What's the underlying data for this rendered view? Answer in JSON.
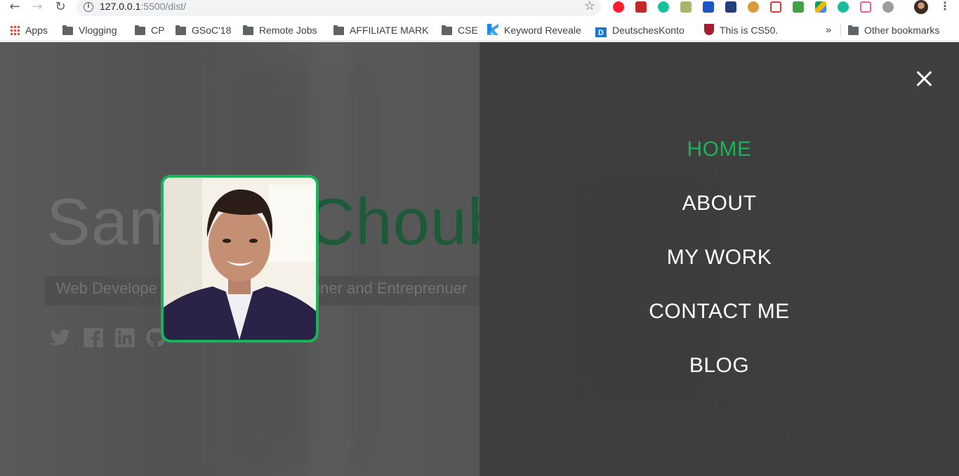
{
  "browser": {
    "url_host": "127.0.0.1",
    "url_path": ":5500/dist/",
    "bookmarks": [
      {
        "label": "Apps",
        "icon": "apps-grid-icon"
      },
      {
        "label": "Vlogging",
        "icon": "folder-icon"
      },
      {
        "label": "CP",
        "icon": "folder-icon"
      },
      {
        "label": "GSoC'18",
        "icon": "folder-icon"
      },
      {
        "label": "Remote Jobs",
        "icon": "folder-icon"
      },
      {
        "label": "AFFILIATE MARK",
        "icon": "folder-icon"
      },
      {
        "label": "CSE",
        "icon": "folder-icon"
      },
      {
        "label": "Keyword Reveale",
        "icon": "keyword-icon"
      },
      {
        "label": "DeutschesKonto",
        "icon": "d-icon"
      },
      {
        "label": "This is CS50.",
        "icon": "harvard-icon"
      }
    ],
    "overflow_label": "»",
    "other_bookmarks": "Other bookmarks"
  },
  "hero": {
    "first_name": "Sam",
    "last_name": "Choubey",
    "tagline_start": "Web Develope",
    "tagline_end": "gner and Entreprenuer"
  },
  "social": [
    "twitter-icon",
    "facebook-icon",
    "linkedin-icon",
    "github-icon"
  ],
  "menu": {
    "items": [
      {
        "label": "HOME",
        "active": true
      },
      {
        "label": "ABOUT",
        "active": false
      },
      {
        "label": "MY WORK",
        "active": false
      },
      {
        "label": "CONTACT ME",
        "active": false
      },
      {
        "label": "BLOG",
        "active": false
      }
    ]
  },
  "colors": {
    "accent": "#19b35b",
    "menu_bg": "#3f3f3f",
    "page_bg": "#555555"
  }
}
